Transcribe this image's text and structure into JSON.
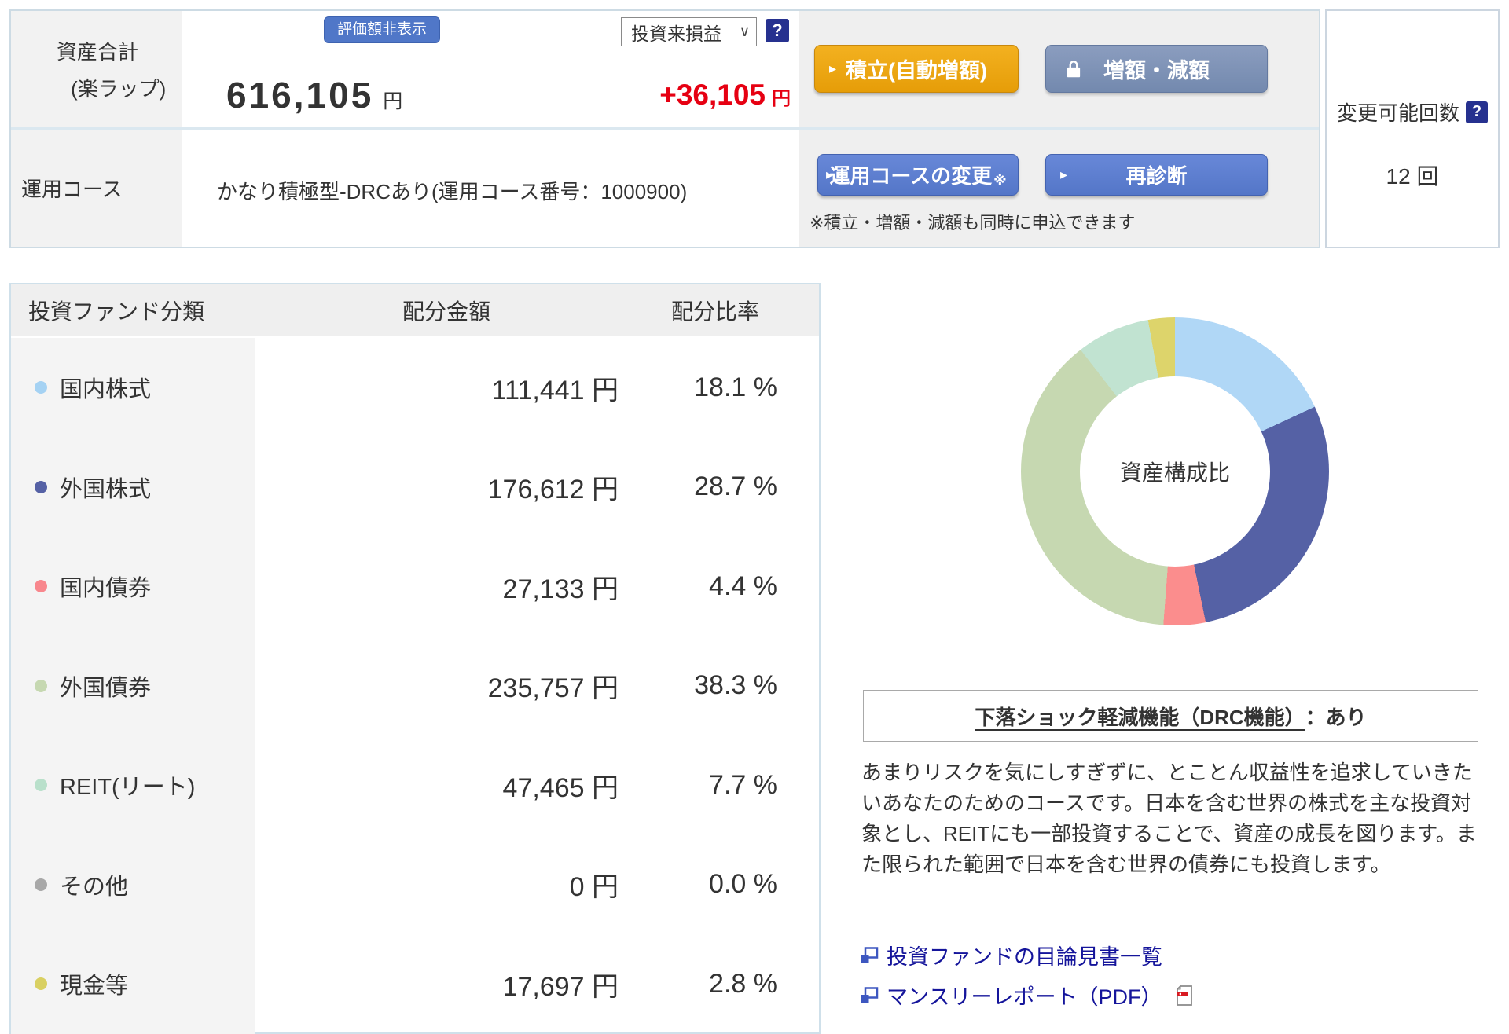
{
  "summary": {
    "row1_label_line1": "資産合計",
    "row1_label_line2": "(楽ラップ)",
    "badge": "評価額非表示",
    "total_value": "616,105",
    "total_unit": "円",
    "pl_select_value": "投資来損益",
    "pl_select_chevron": "∨",
    "help_icon": "?",
    "pl_value": "+36,105",
    "pl_unit": "円",
    "row2_label": "運用コース",
    "course_text": "かなり積極型-DRCあり(運用コース番号：1000900)",
    "buttons": {
      "arrow": "▸",
      "tsumitate": "積立(自動増額)",
      "zogaku": "増額・減額",
      "course_change": "運用コースの変更",
      "course_change_mark": "※",
      "rediagnosis": "再診断"
    },
    "note": "※積立・増額・減額も同時に申込できます"
  },
  "change_count": {
    "label": "変更可能回数",
    "help_icon": "?",
    "value": "12 回"
  },
  "table": {
    "headers": {
      "category": "投資ファンド分類",
      "amount": "配分金額",
      "ratio": "配分比率"
    },
    "rows": [
      {
        "label": "国内株式",
        "amount": "111,441 円",
        "ratio": "18.1 %",
        "color": "#a5d2f3"
      },
      {
        "label": "外国株式",
        "amount": "176,612 円",
        "ratio": "28.7 %",
        "color": "#5561a5"
      },
      {
        "label": "国内債券",
        "amount": "27,133 円",
        "ratio": "4.4 %",
        "color": "#f8878d"
      },
      {
        "label": "外国債券",
        "amount": "235,757 円",
        "ratio": "38.3 %",
        "color": "#c6d8b1"
      },
      {
        "label": "REIT(リート)",
        "amount": "47,465 円",
        "ratio": "7.7 %",
        "color": "#b9e0cb"
      },
      {
        "label": "その他",
        "amount": "0 円",
        "ratio": "0.0 %",
        "color": "#a8a8a8"
      },
      {
        "label": "現金等",
        "amount": "17,697 円",
        "ratio": "2.8 %",
        "color": "#d9d062"
      }
    ]
  },
  "chart_data": {
    "type": "pie",
    "donut": true,
    "center_label": "資産構成比",
    "categories": [
      "国内株式",
      "外国株式",
      "国内債券",
      "外国債券",
      "REIT(リート)",
      "その他",
      "現金等"
    ],
    "values": [
      18.1,
      28.7,
      4.4,
      38.3,
      7.7,
      0.0,
      2.8
    ],
    "colors": [
      "#b0d7f6",
      "#5561a5",
      "#fb8d8d",
      "#c6d8b1",
      "#c1e3d1",
      "#a8a8a8",
      "#ddd46b"
    ],
    "start_angle_deg": 0,
    "direction": "clockwise"
  },
  "drc": {
    "title": "下落ショック軽減機能（DRC機能）",
    "suffix": "：あり"
  },
  "description": "あまりリスクを気にしすぎずに、とことん収益性を追求していきたいあなたのためのコースです。日本を含む世界の株式を主な投資対象とし、REITにも一部投資することで、資産の成長を図ります。また限られた範囲で日本を含む世界の債券にも投資します。",
  "links": {
    "prospectus": "投資ファンドの目論見書一覧",
    "monthly_report": "マンスリーレポート（PDF）"
  }
}
